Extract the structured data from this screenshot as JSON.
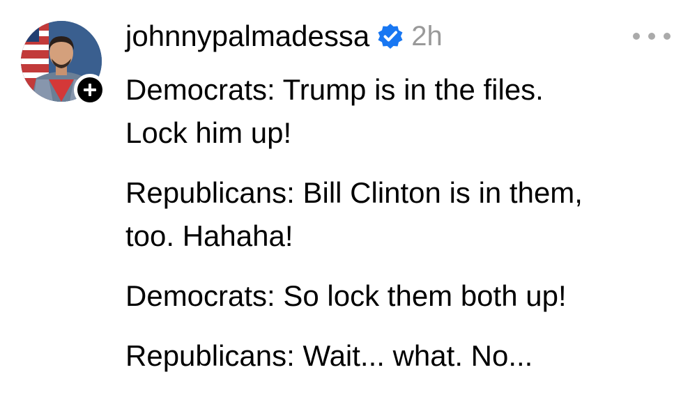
{
  "post": {
    "username": "johnnypalmadessa",
    "timestamp": "2h",
    "verified_icon": "verified-badge-icon",
    "more_icon": "more-options-icon",
    "follow_icon": "plus-icon",
    "paragraphs": [
      {
        "line1": "Democrats: Trump is in the files.",
        "line2": "Lock him up!"
      },
      {
        "line1": "Republicans: Bill Clinton is in them,",
        "line2": "too. Hahaha!"
      },
      {
        "line1": "Democrats: So lock them both up!",
        "line2": ""
      },
      {
        "line1": "Republicans: Wait... what. No...",
        "line2": ""
      }
    ]
  },
  "colors": {
    "verified": "#1877f2",
    "timestamp": "#999999",
    "more_dots": "#aaaaaa",
    "follow_badge": "#000000"
  }
}
